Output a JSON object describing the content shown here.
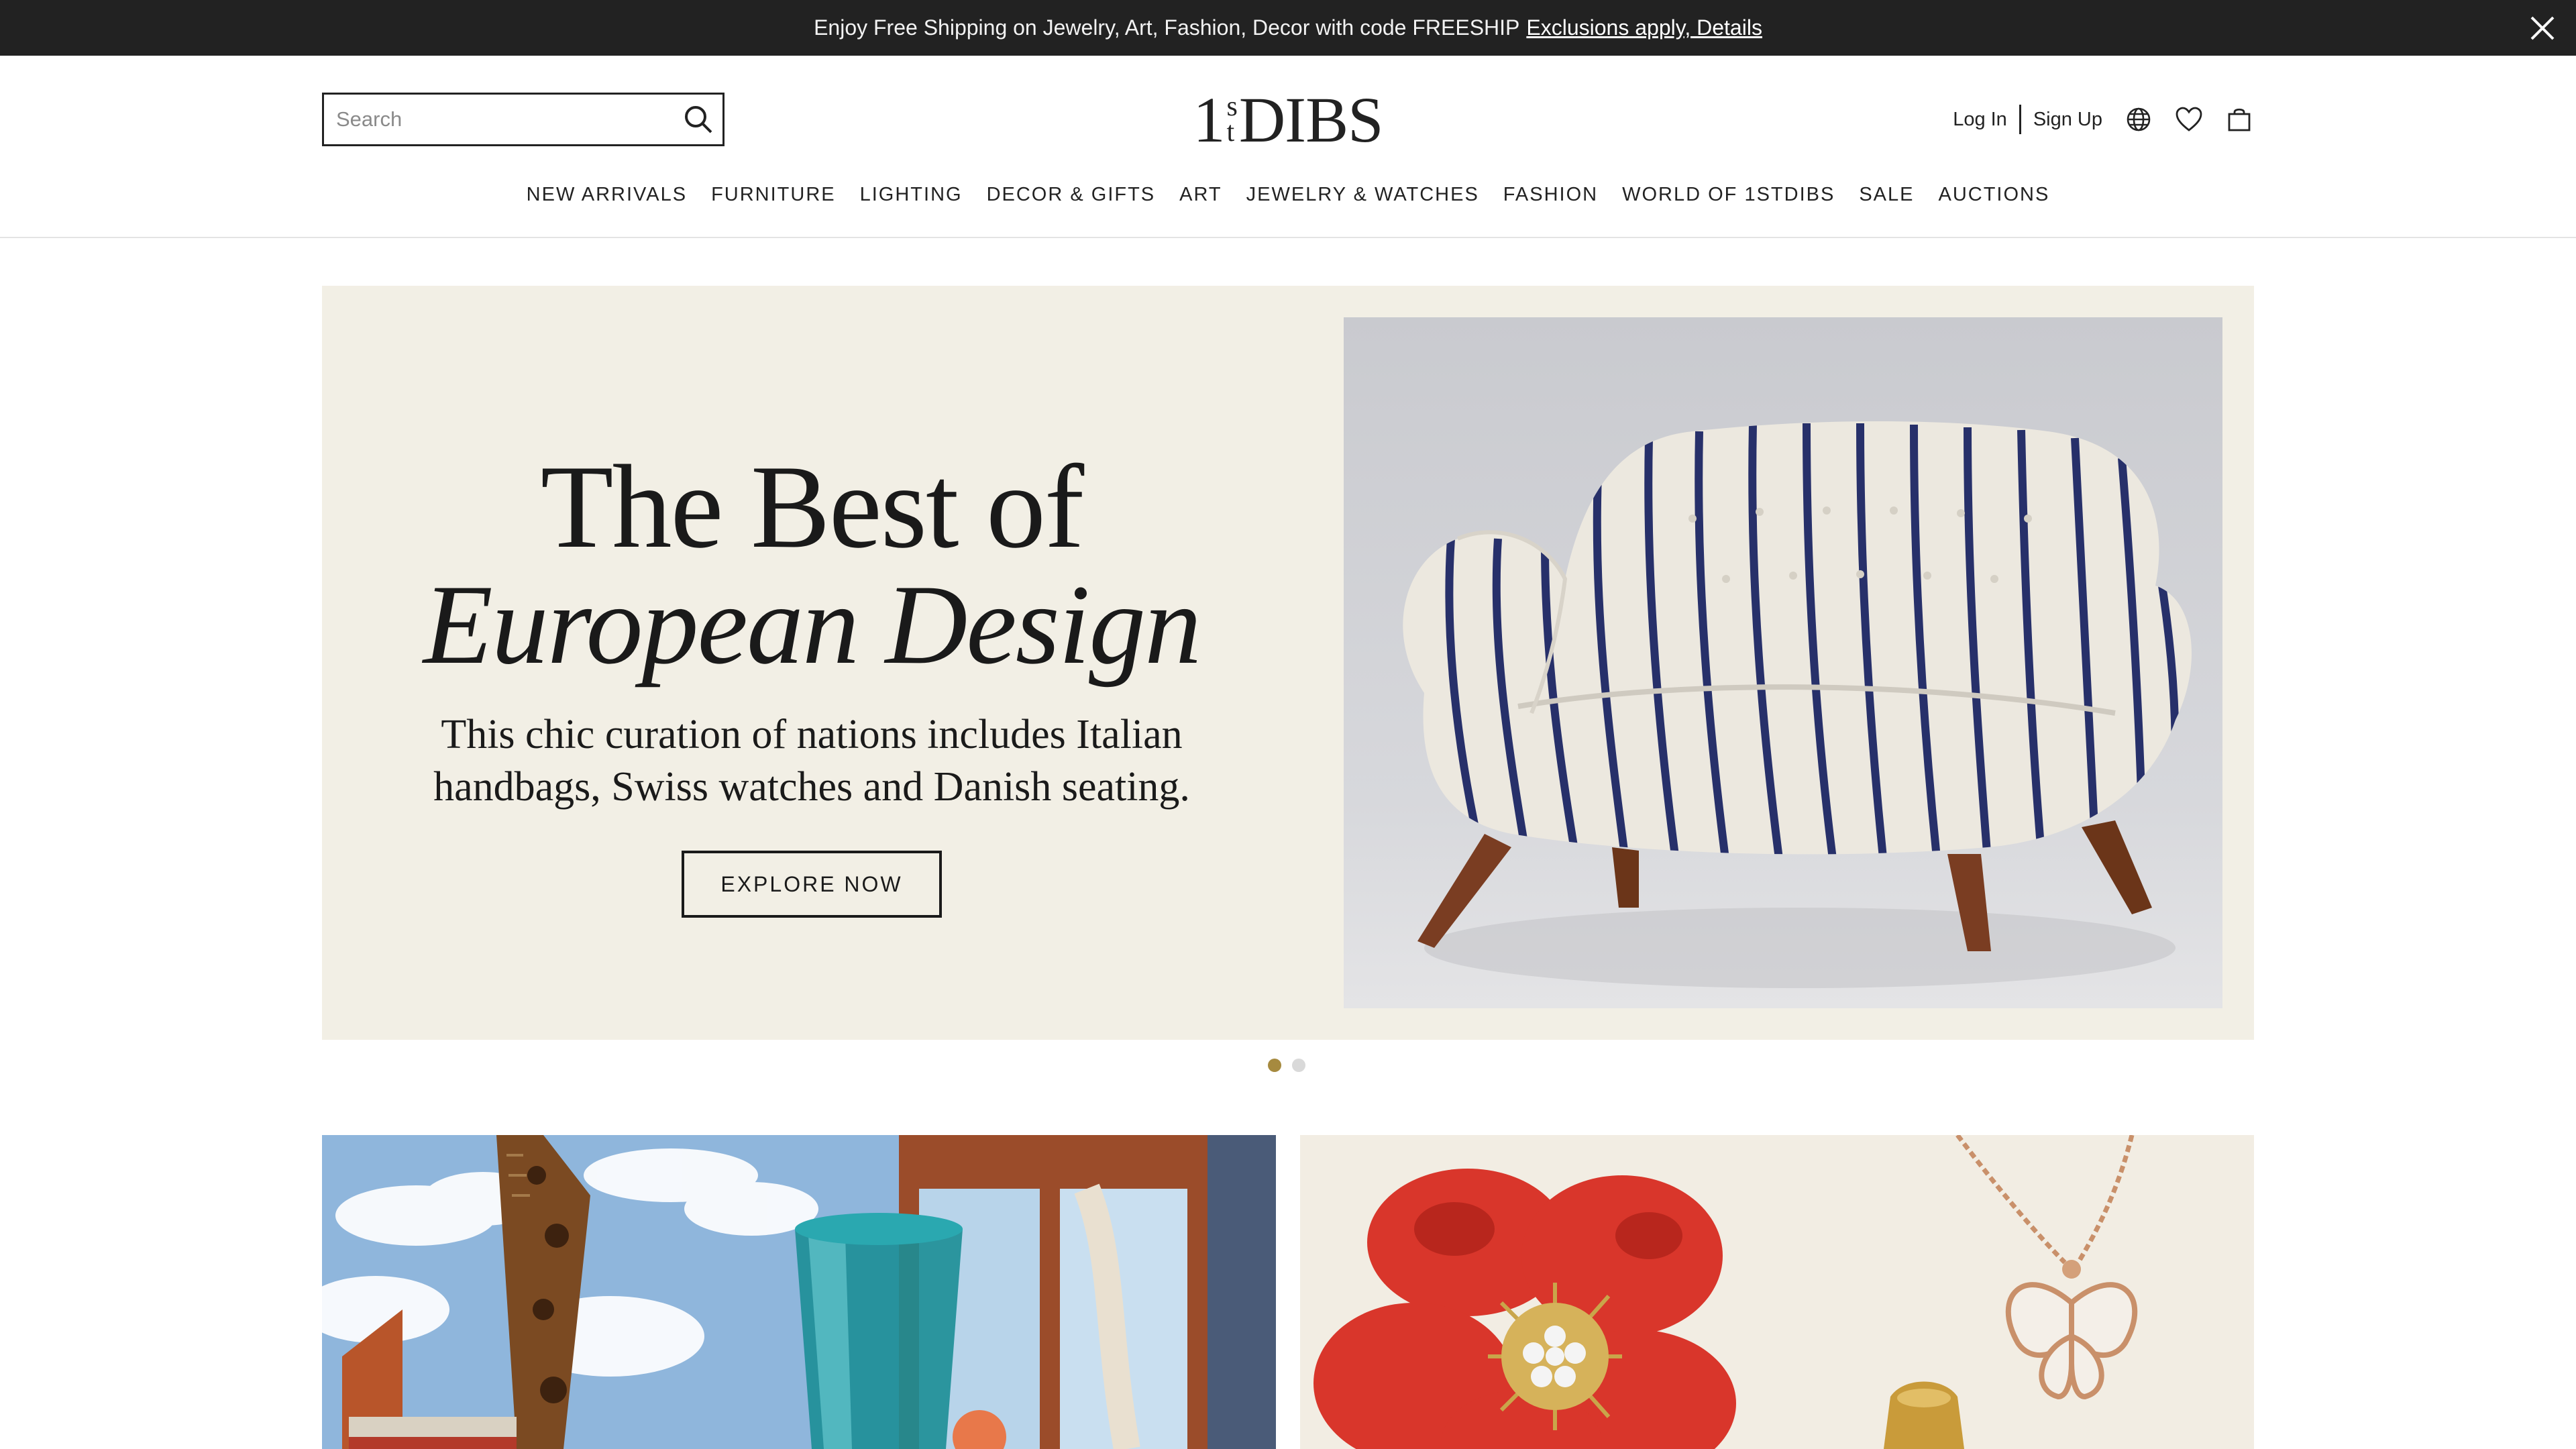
{
  "promo": {
    "text": "Enjoy Free Shipping on Jewelry, Art, Fashion, Decor with code FREESHIP",
    "link": "Exclusions apply, Details",
    "close_icon": "close-icon"
  },
  "header": {
    "search": {
      "placeholder": "Search",
      "value": "",
      "icon": "search-icon"
    },
    "logo": {
      "one": "1",
      "s": "s",
      "t": "t",
      "dibs": "DIBS"
    },
    "account": {
      "login": "Log In",
      "signup": "Sign Up",
      "icons": [
        "globe-icon",
        "heart-icon",
        "shopping-bag-icon"
      ]
    },
    "nav": [
      "NEW ARRIVALS",
      "FURNITURE",
      "LIGHTING",
      "DECOR & GIFTS",
      "ART",
      "JEWELRY & WATCHES",
      "FASHION",
      "WORLD OF 1STDIBS",
      "SALE",
      "AUCTIONS"
    ]
  },
  "hero": {
    "title_line1": "The Best of",
    "title_line2": "European Design",
    "subtitle_line1": "This chic curation of nations includes Italian",
    "subtitle_line2": "handbags, Swiss watches and Danish seating.",
    "cta": "EXPLORE NOW",
    "image": "striped-loveseat-photo",
    "slides_total": 2,
    "slide_active": 1
  },
  "cards": [
    {
      "image": "surreal-interior-collage-photo"
    },
    {
      "image": "coral-flower-brooch-and-butterfly-necklace-photo"
    }
  ],
  "colors": {
    "promo_bg": "#222222",
    "hero_bg": "#f2efe5",
    "dot_active": "#a68a3f",
    "dot_inactive": "#d9d9d9"
  }
}
